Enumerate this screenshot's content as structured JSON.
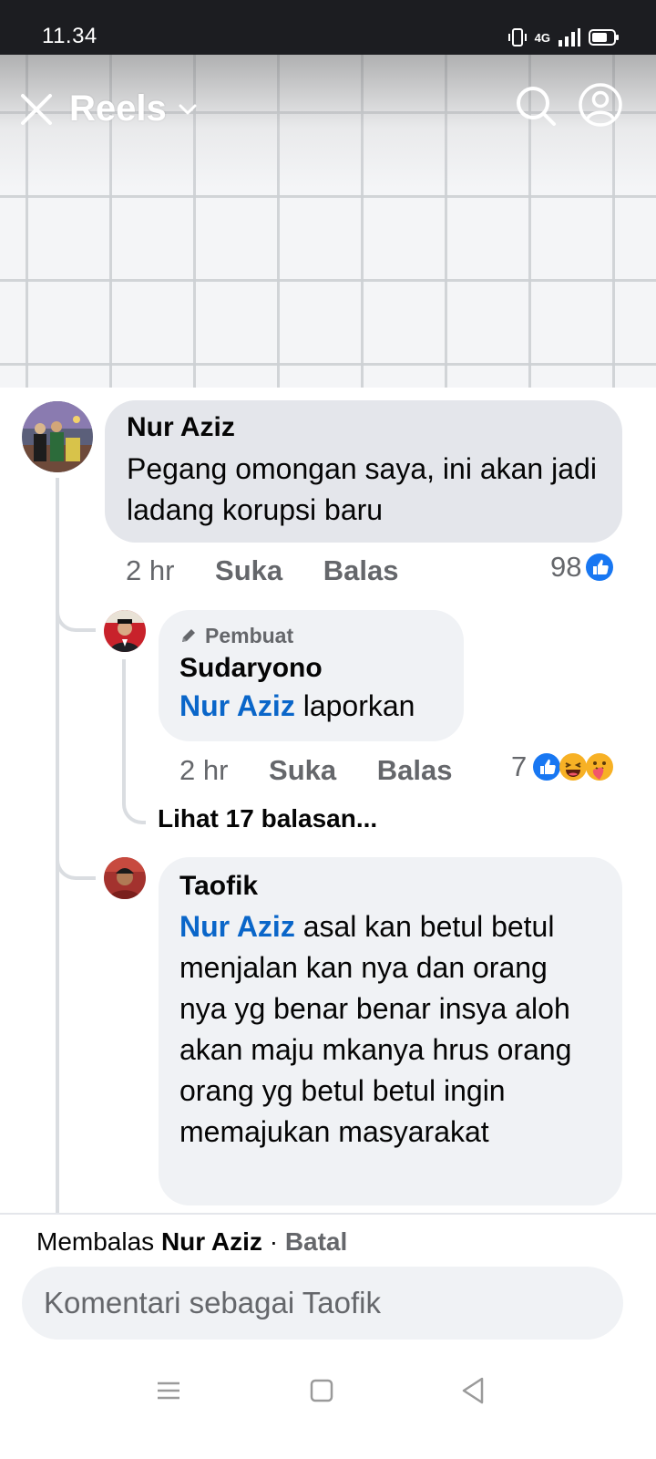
{
  "status_bar": {
    "time": "11.34",
    "network": "4G"
  },
  "header": {
    "title": "Reels"
  },
  "icons": {
    "close": "close-icon",
    "dropdown": "chevron-down-icon",
    "search": "search-icon",
    "profile": "profile-icon",
    "author_badge": "pencil-icon",
    "like": "like-reaction-icon",
    "haha": "haha-reaction-icon",
    "care": "care-reaction-icon"
  },
  "colors": {
    "mention": "#0a66c9",
    "like_blue": "#1877f2",
    "bubble": "#e4e6eb",
    "bubble_light": "#f0f2f5"
  },
  "comments": [
    {
      "author": "Nur Aziz",
      "text": "Pegang omongan saya, ini akan jadi ladang korupsi baru",
      "time": "2 hr",
      "like_label": "Suka",
      "reply_label": "Balas",
      "reaction_count": "98"
    }
  ],
  "replies": [
    {
      "badge": "Pembuat",
      "author": "Sudaryono",
      "mention": "Nur Aziz",
      "text": " laporkan",
      "time": "2 hr",
      "like_label": "Suka",
      "reply_label": "Balas",
      "reaction_count": "7",
      "view_replies": "Lihat 17 balasan..."
    },
    {
      "author": "Taofik",
      "mention": "Nur Aziz",
      "text": " asal kan betul betul menjalan kan nya dan orang nya yg benar benar  insya aloh akan maju mkanya hrus orang orang yg betul betul ingin memajukan masyarakat"
    }
  ],
  "reply_bar": {
    "replying_to_prefix": "Membalas",
    "replying_to_name": "Nur Aziz",
    "separator": "·",
    "cancel_label": "Batal",
    "placeholder": "Komentari sebagai Taofik"
  }
}
